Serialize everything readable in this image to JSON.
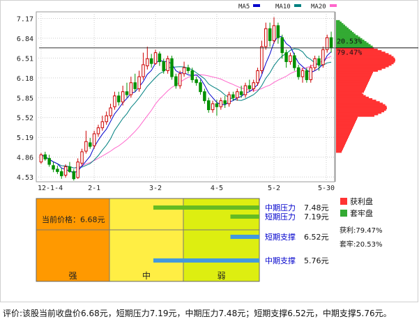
{
  "chart_data": [
    {
      "type": "candlestick",
      "legend": [
        "MA5",
        "MA10",
        "MA20"
      ],
      "colors": {
        "up": "#cc0000",
        "down": "#009000",
        "ma5": "#0000cc",
        "ma10": "#008080",
        "ma20": "#ff66cc",
        "profit": "#ff3333",
        "trapped": "#33aa33"
      },
      "y_ticks": [
        7.17,
        6.84,
        6.51,
        6.18,
        5.85,
        5.52,
        5.19,
        4.86,
        4.53
      ],
      "ylim": [
        4.45,
        7.28
      ],
      "x_ticks": [
        "12-1-4",
        "2-1",
        "3-2",
        "4-5",
        "5-2",
        "5-30"
      ],
      "x_tick_index": [
        0,
        13,
        28,
        43,
        57,
        71
      ],
      "profit_pct_label": "79.47%",
      "trapped_pct_label": "20.53%",
      "current_price_line": 6.68,
      "candles": [
        [
          4.78,
          4.9,
          4.75,
          4.93
        ],
        [
          4.9,
          4.83,
          4.8,
          4.95
        ],
        [
          4.84,
          4.74,
          4.7,
          4.9
        ],
        [
          4.72,
          4.66,
          4.61,
          4.78
        ],
        [
          4.66,
          4.62,
          4.58,
          4.72
        ],
        [
          4.62,
          4.55,
          4.5,
          4.68
        ],
        [
          4.56,
          4.7,
          4.52,
          4.74
        ],
        [
          4.7,
          4.62,
          4.6,
          4.78
        ],
        [
          4.62,
          4.5,
          4.47,
          4.66
        ],
        [
          4.52,
          4.78,
          4.5,
          4.84
        ],
        [
          4.76,
          4.95,
          4.72,
          5.0
        ],
        [
          4.96,
          5.12,
          4.92,
          5.3
        ],
        [
          5.1,
          5.04,
          5.0,
          5.18
        ],
        [
          5.05,
          5.25,
          5.0,
          5.3
        ],
        [
          5.25,
          5.35,
          5.2,
          5.4
        ],
        [
          5.35,
          5.45,
          5.3,
          5.55
        ],
        [
          5.45,
          5.55,
          5.4,
          5.62
        ],
        [
          5.55,
          5.68,
          5.5,
          5.75
        ],
        [
          5.7,
          5.88,
          5.65,
          5.95
        ],
        [
          5.88,
          5.78,
          5.72,
          5.95
        ],
        [
          5.78,
          5.95,
          5.72,
          6.05
        ],
        [
          5.95,
          5.9,
          5.85,
          6.1
        ],
        [
          5.9,
          6.1,
          5.85,
          6.2
        ],
        [
          6.1,
          6.0,
          5.95,
          6.25
        ],
        [
          6.0,
          6.2,
          5.95,
          6.3
        ],
        [
          6.2,
          6.4,
          6.15,
          6.6
        ],
        [
          6.38,
          6.5,
          6.32,
          6.7
        ],
        [
          6.5,
          6.42,
          6.35,
          6.58
        ],
        [
          6.42,
          6.6,
          6.4,
          6.65
        ],
        [
          6.58,
          6.45,
          6.38,
          6.62
        ],
        [
          6.45,
          6.3,
          6.25,
          6.5
        ],
        [
          6.3,
          6.5,
          6.25,
          6.55
        ],
        [
          6.5,
          6.2,
          6.15,
          6.55
        ],
        [
          6.2,
          6.05,
          6.0,
          6.25
        ],
        [
          6.05,
          6.25,
          6.0,
          6.3
        ],
        [
          6.25,
          6.35,
          6.2,
          6.45
        ],
        [
          6.35,
          6.3,
          6.25,
          6.4
        ],
        [
          6.3,
          6.15,
          6.1,
          6.35
        ],
        [
          6.15,
          6.1,
          6.05,
          6.2
        ],
        [
          6.1,
          5.95,
          5.9,
          6.15
        ],
        [
          5.95,
          5.8,
          5.75,
          6.0
        ],
        [
          5.8,
          5.65,
          5.6,
          5.85
        ],
        [
          5.65,
          5.75,
          5.6,
          5.8
        ],
        [
          5.75,
          5.7,
          5.55,
          5.82
        ],
        [
          5.7,
          5.8,
          5.65,
          5.85
        ],
        [
          5.8,
          5.75,
          5.68,
          5.88
        ],
        [
          5.75,
          5.9,
          5.7,
          5.95
        ],
        [
          5.9,
          5.85,
          5.8,
          5.95
        ],
        [
          5.85,
          5.95,
          5.8,
          6.0
        ],
        [
          5.95,
          5.9,
          5.85,
          6.05
        ],
        [
          5.9,
          6.05,
          5.85,
          6.1
        ],
        [
          6.05,
          6.0,
          5.95,
          6.15
        ],
        [
          6.0,
          6.1,
          5.95,
          6.15
        ],
        [
          6.1,
          6.3,
          6.05,
          6.35
        ],
        [
          6.3,
          6.7,
          6.25,
          6.8
        ],
        [
          6.7,
          7.0,
          6.65,
          7.1
        ],
        [
          7.0,
          6.8,
          6.7,
          7.1
        ],
        [
          6.8,
          7.05,
          6.75,
          7.19
        ],
        [
          7.05,
          6.85,
          6.75,
          7.1
        ],
        [
          6.85,
          6.6,
          6.5,
          6.9
        ],
        [
          6.6,
          6.45,
          6.35,
          6.65
        ],
        [
          6.45,
          6.55,
          6.4,
          6.6
        ],
        [
          6.55,
          6.35,
          6.3,
          6.6
        ],
        [
          6.35,
          6.2,
          6.15,
          6.4
        ],
        [
          6.2,
          6.3,
          6.1,
          6.35
        ],
        [
          6.3,
          6.15,
          6.1,
          6.35
        ],
        [
          6.15,
          6.35,
          6.1,
          6.4
        ],
        [
          6.35,
          6.5,
          6.3,
          6.55
        ],
        [
          6.5,
          6.4,
          6.3,
          6.55
        ],
        [
          6.4,
          6.65,
          6.35,
          6.7
        ],
        [
          6.65,
          6.85,
          6.6,
          6.9
        ],
        [
          6.85,
          6.68,
          6.6,
          6.95
        ]
      ]
    },
    {
      "type": "strength-panel",
      "zones": [
        "强",
        "中",
        "弱"
      ],
      "current_price_label": "当前价格：6.68元",
      "levels": [
        {
          "name": "中期压力",
          "value": "7.48元",
          "color": "#66bb22",
          "kind": "pressure",
          "bar_from": 0.45,
          "bar_to": 1.0
        },
        {
          "name": "短期压力",
          "value": "7.19元",
          "color": "#66bb22",
          "kind": "pressure",
          "bar_from": 0.85,
          "bar_to": 1.0
        },
        {
          "name": "短期支撑",
          "value": "6.52元",
          "color": "#4499dd",
          "kind": "support",
          "bar_from": 0.85,
          "bar_to": 1.0
        },
        {
          "name": "中期支撑",
          "value": "5.76元",
          "color": "#4499dd",
          "kind": "support",
          "bar_from": 0.45,
          "bar_to": 1.0
        }
      ],
      "legend": [
        {
          "label": "获利盘",
          "color": "#ff3333"
        },
        {
          "label": "套牢盘",
          "color": "#33aa33"
        }
      ],
      "profit_text": "获利:79.47%",
      "trapped_text": "套牢:20.53%"
    }
  ],
  "footer": {
    "text": "评价:该股当前收盘价6.68元，短期压力7.19元，中期压力7.48元；短期支撑6.52元，中期支撑5.76元。"
  }
}
